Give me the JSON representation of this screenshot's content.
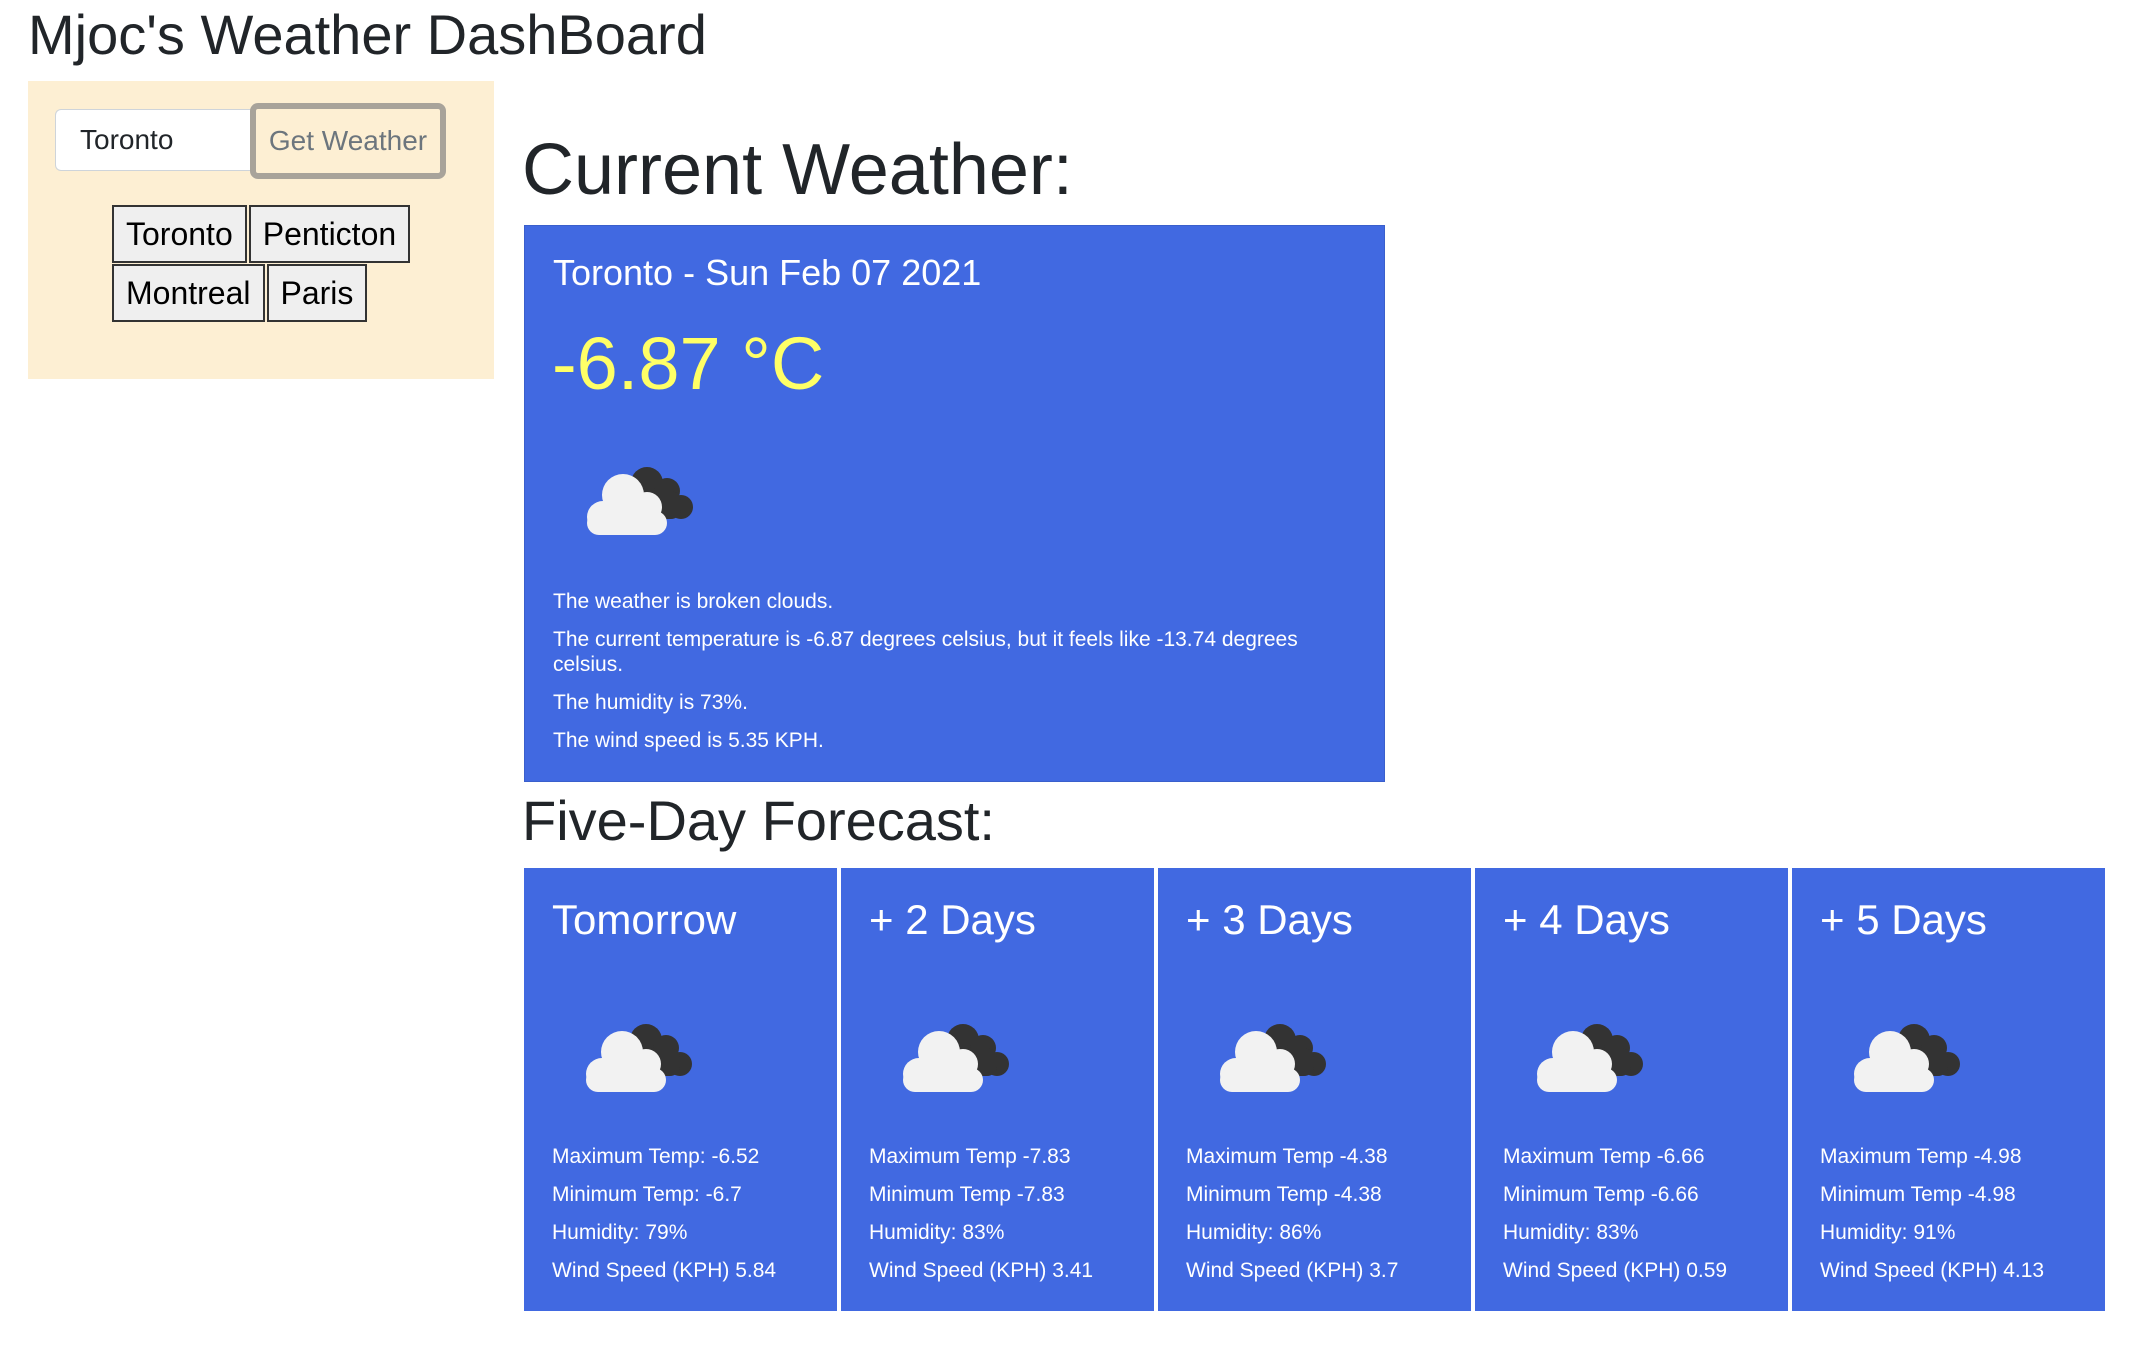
{
  "app": {
    "title": "Mjoc's Weather DashBoard"
  },
  "sidebar": {
    "search_value": "Toronto",
    "button_label": "Get Weather",
    "history": [
      "Toronto",
      "Penticton",
      "Montreal",
      "Paris"
    ]
  },
  "current": {
    "heading": "Current Weather:",
    "city_date": "Toronto - Sun Feb 07 2021",
    "temp": "-6.87 °C",
    "icon": "broken-clouds-icon",
    "details": [
      "The weather is broken clouds.",
      "The current temperature is -6.87 degrees celsius, but it feels like -13.74 degrees celsius.",
      "The humidity is 73%.",
      "The wind speed is 5.35 KPH."
    ]
  },
  "forecast": {
    "heading": "Five-Day Forecast:",
    "days": [
      {
        "label": "Tomorrow",
        "icon": "broken-clouds-icon",
        "max": "Maximum Temp: -6.52",
        "min": "Minimum Temp: -6.7",
        "humidity": "Humidity: 79%",
        "wind": "Wind Speed (KPH) 5.84"
      },
      {
        "label": "+ 2 Days",
        "icon": "broken-clouds-icon",
        "max": "Maximum Temp -7.83",
        "min": "Minimum Temp -7.83",
        "humidity": "Humidity: 83%",
        "wind": "Wind Speed (KPH) 3.41"
      },
      {
        "label": "+ 3 Days",
        "icon": "broken-clouds-icon",
        "max": "Maximum Temp -4.38",
        "min": "Minimum Temp -4.38",
        "humidity": "Humidity: 86%",
        "wind": "Wind Speed (KPH) 3.7"
      },
      {
        "label": "+ 4 Days",
        "icon": "broken-clouds-icon",
        "max": "Maximum Temp -6.66",
        "min": "Minimum Temp -6.66",
        "humidity": "Humidity: 83%",
        "wind": "Wind Speed (KPH) 0.59"
      },
      {
        "label": "+ 5 Days",
        "icon": "broken-clouds-icon",
        "max": "Maximum Temp -4.98",
        "min": "Minimum Temp -4.98",
        "humidity": "Humidity: 91%",
        "wind": "Wind Speed (KPH) 4.13"
      }
    ]
  },
  "colors": {
    "card_bg": "#4169e1",
    "temp_accent": "#ffff66",
    "sidebar_bg": "#fdefd3"
  }
}
